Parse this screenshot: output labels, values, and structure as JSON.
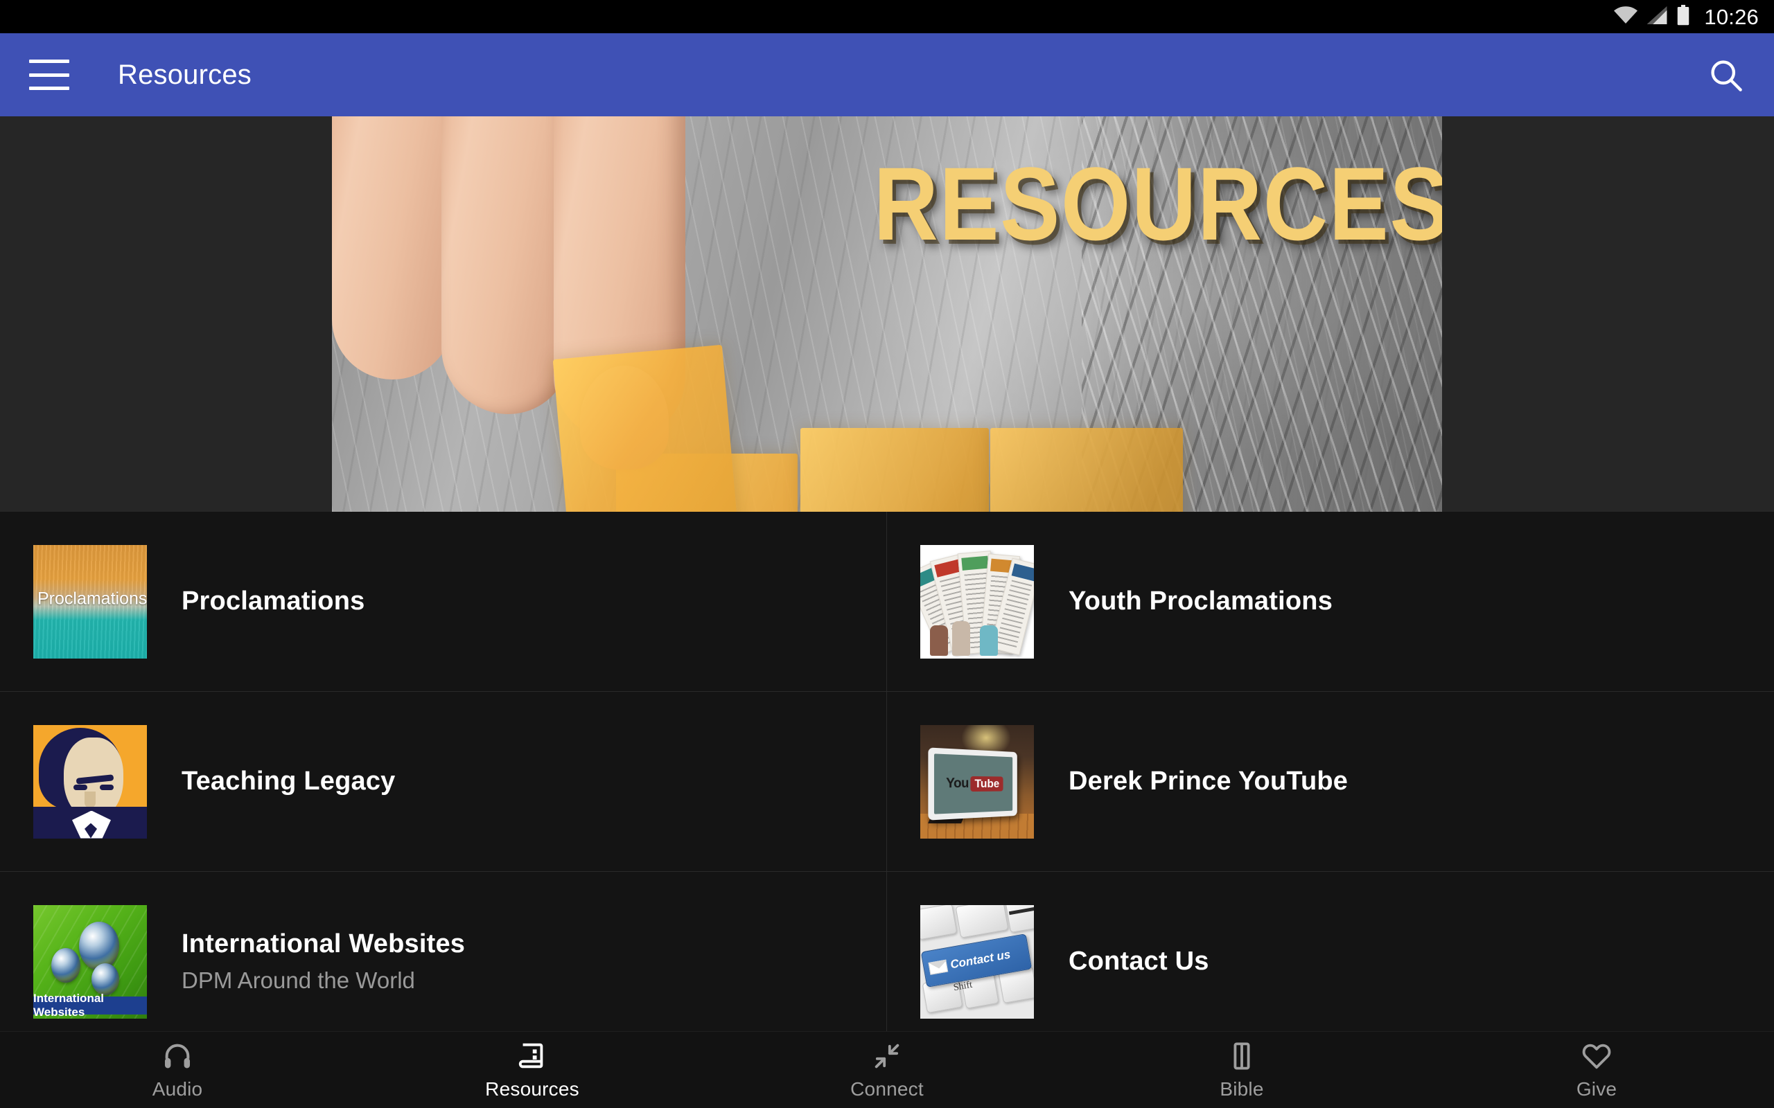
{
  "status_bar": {
    "clock": "10:26",
    "icons": [
      "wifi-icon",
      "cellular-signal-icon",
      "battery-icon"
    ]
  },
  "app_bar": {
    "menu_icon": "hamburger-menu-icon",
    "title": "Resources",
    "search_icon": "search-icon",
    "background_color": "#3f51b5"
  },
  "banner": {
    "headline": "RESOURCES",
    "alt": "Hand placing golden glass panels over a grayscale wheat field",
    "text_color": "#f5cf74",
    "surround_color": "#262626"
  },
  "grid": {
    "items": [
      {
        "title": "Proclamations",
        "subtitle": "",
        "thumb_name": "proclamations-thumbnail",
        "thumb_caption": "Proclamations"
      },
      {
        "title": "Youth Proclamations",
        "subtitle": "",
        "thumb_name": "youth-proclamations-thumbnail",
        "thumb_caption": ""
      },
      {
        "title": "Teaching Legacy",
        "subtitle": "",
        "thumb_name": "teaching-legacy-thumbnail",
        "thumb_caption": ""
      },
      {
        "title": "Derek Prince YouTube",
        "subtitle": "",
        "thumb_name": "derek-prince-youtube-thumbnail",
        "thumb_caption_you": "You",
        "thumb_caption_tube": "Tube"
      },
      {
        "title": "International Websites",
        "subtitle": "DPM Around the World",
        "thumb_name": "international-websites-thumbnail",
        "thumb_caption": "International Websites"
      },
      {
        "title": "Contact Us",
        "subtitle": "",
        "thumb_name": "contact-us-thumbnail",
        "thumb_caption": "Contact us",
        "thumb_key_label": "Shift"
      }
    ]
  },
  "bottom_nav": {
    "items": [
      {
        "label": "Audio",
        "icon": "headphones-icon",
        "active": false
      },
      {
        "label": "Resources",
        "icon": "book-icon",
        "active": true
      },
      {
        "label": "Connect",
        "icon": "converging-arrows-icon",
        "active": false
      },
      {
        "label": "Bible",
        "icon": "bible-book-icon",
        "active": false
      },
      {
        "label": "Give",
        "icon": "heart-icon",
        "active": false
      }
    ],
    "active_color": "#ffffff",
    "inactive_color": "#9e9e9e"
  }
}
